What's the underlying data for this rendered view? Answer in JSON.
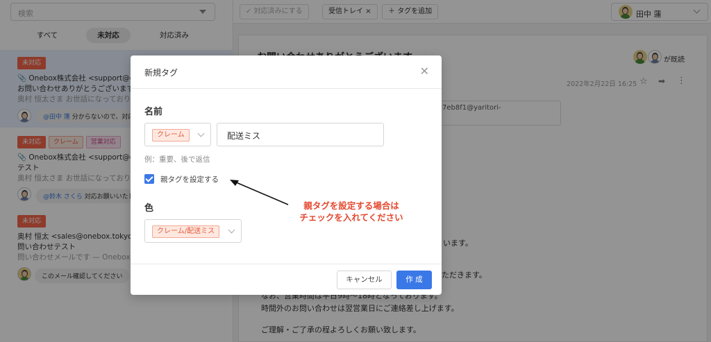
{
  "left": {
    "search_placeholder": "検索",
    "tabs": [
      "すべて",
      "未対応",
      "対応済み"
    ],
    "items": [
      {
        "badges": [
          "未対応"
        ],
        "from": "Onebox株式会社 <support@ex",
        "subject": "お問い合わせありがとうございます",
        "preview": "奥村 恒太さま お世話になっており",
        "comment_mention": "@田中 蓮",
        "comment": " 分からないので、対応お"
      },
      {
        "badges": [
          "未対応",
          "クレーム",
          "営業対応"
        ],
        "from": "Onebox株式会社 <support@ex",
        "subject": "テスト",
        "preview": "奥村 恒太さま お世話になっており",
        "comment_mention": "@鈴木 さくら",
        "comment": " 対応お願いいたします"
      },
      {
        "badges": [
          "未対応"
        ],
        "from": "奥村 恒太 <sales@onebox.tokyo>",
        "subject": "問い合わせテスト",
        "preview": "問い合わせメールです — Onebox",
        "comment": "このメール確認してください"
      }
    ]
  },
  "topbar": {
    "resolve_label": "対応済みにする",
    "inbox_tag": "受信トレイ",
    "add_tag_label": "タグを追加",
    "user_name": "田中 蓮"
  },
  "mail": {
    "title": "お問い合わせありがとうございます",
    "seen_label": "が既読",
    "date": "2022年2月22日 16:25",
    "address_fragment": "7eb8f1@yaritori-",
    "lines": [
      "います。",
      "ただきます。",
      "なお、営業時間は平日9時〜18時となっております。",
      "時間外のお問い合わせは翌営業日にご連絡差し上げます。",
      "ご理解・ご了承の程よろしくお願い致します。"
    ]
  },
  "dialog": {
    "title": "新規タグ",
    "name_label": "名前",
    "parent_tag": "クレーム",
    "name_value": "配送ミス",
    "hint": "例：重要、後で返信",
    "checkbox_label": "親タグを設定する",
    "checkbox_checked": true,
    "color_label": "色",
    "color_preview_tag": "クレーム/配送ミス",
    "cancel_label": "キャンセル",
    "create_label": "作 成"
  },
  "annotation": {
    "line1": "親タグを設定する場合は",
    "line2": "チェックを入れてください",
    "color": "#e3492f"
  },
  "colors": {
    "accent": "#3b78e7",
    "unhandled": "#f5664a"
  }
}
